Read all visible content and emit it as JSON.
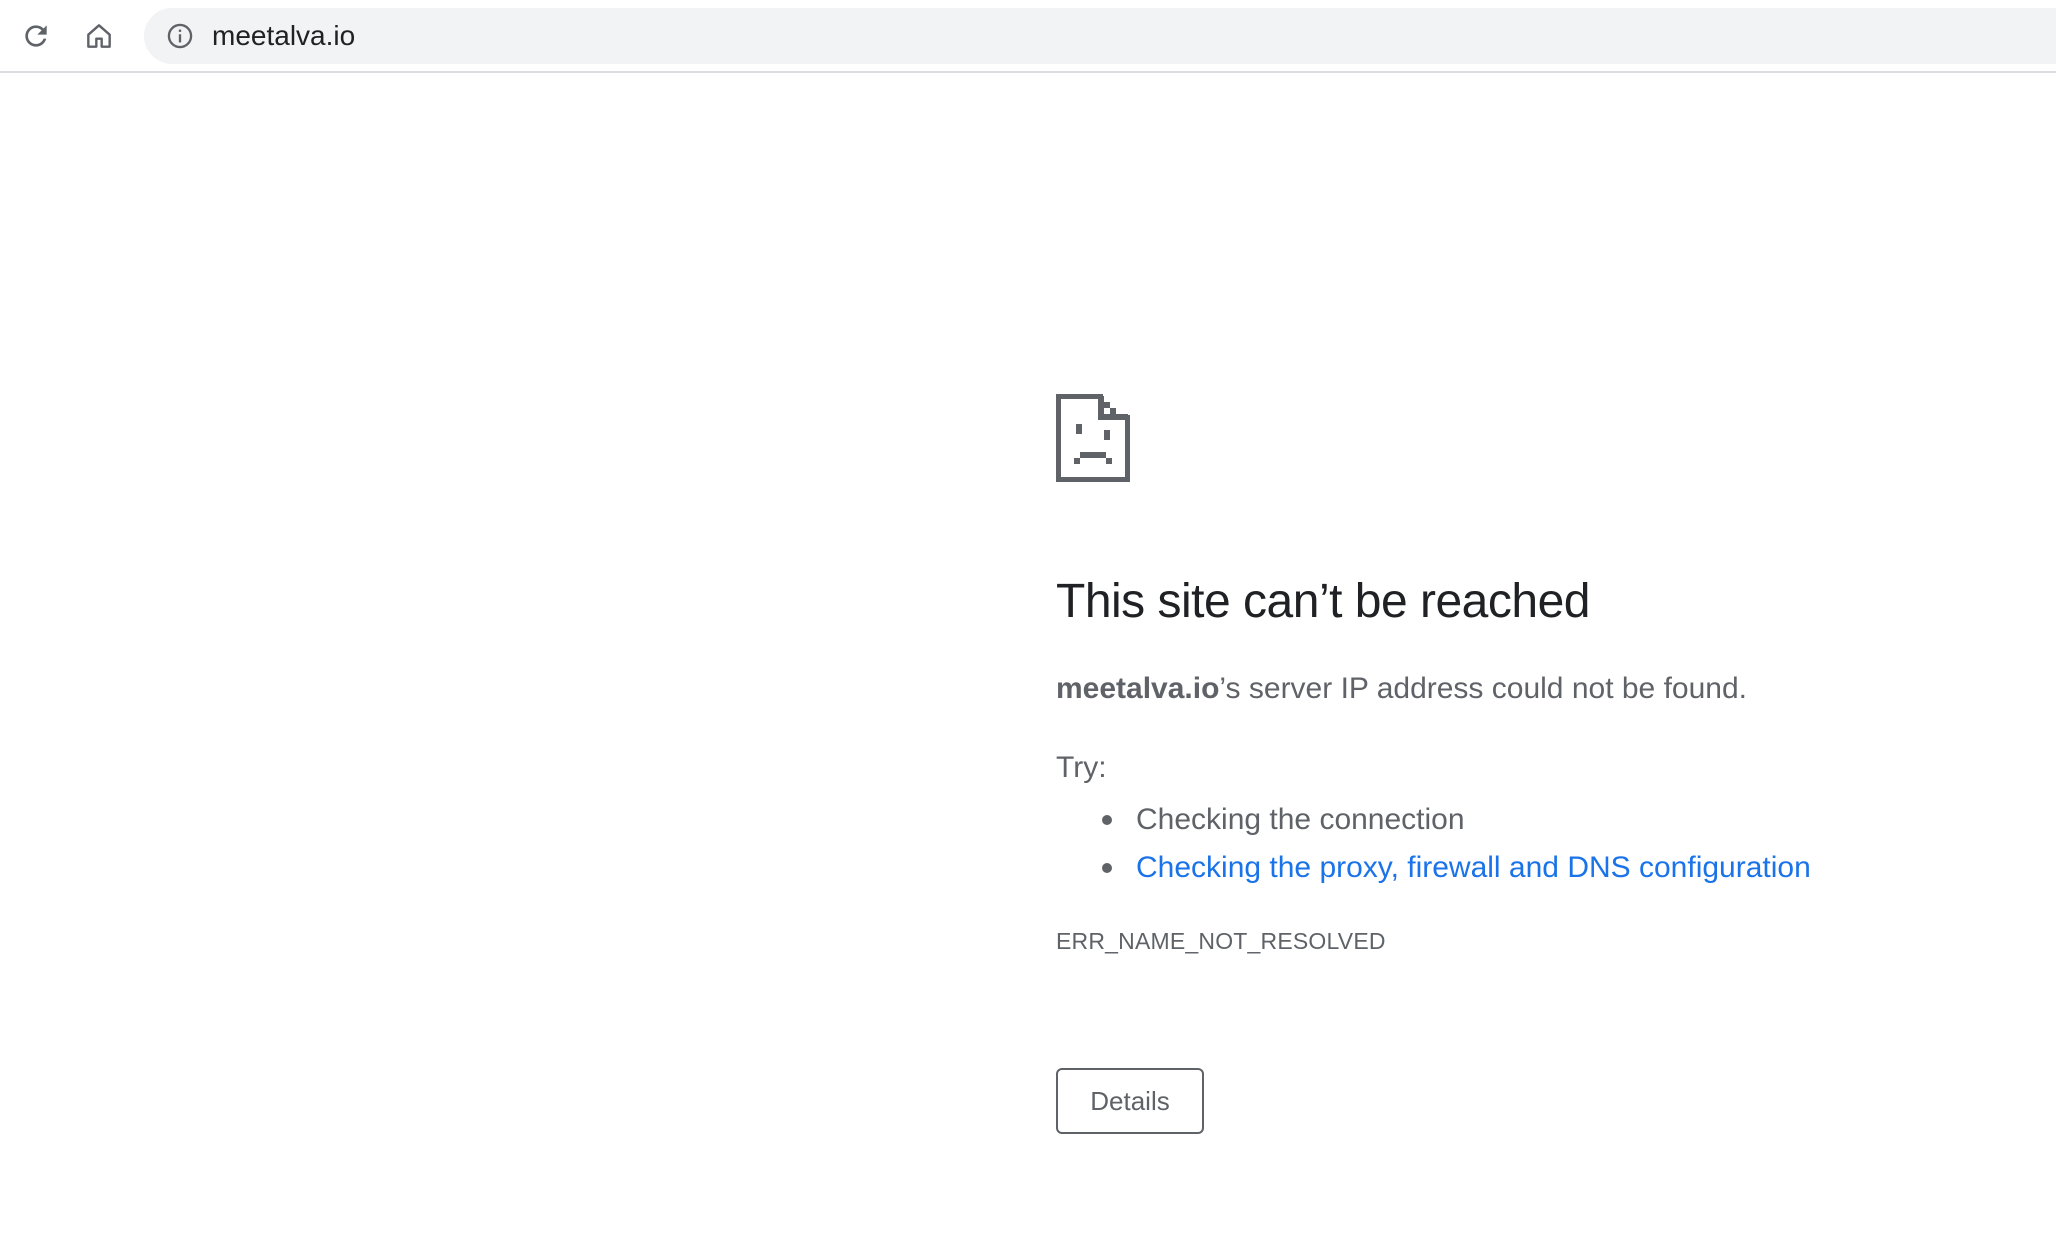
{
  "toolbar": {
    "url": "meetalva.io",
    "reload_icon": "reload-icon",
    "home_icon": "home-icon",
    "info_icon": "info-icon"
  },
  "error_page": {
    "icon": "sad-document-icon",
    "heading": "This site can’t be reached",
    "summary_host": "meetalva.io",
    "summary_rest": "’s server IP address could not be found.",
    "try_label": "Try:",
    "suggestions": [
      {
        "text": "Checking the connection",
        "link": false
      },
      {
        "text": "Checking the proxy, firewall and DNS configuration",
        "link": true
      }
    ],
    "error_code": "ERR_NAME_NOT_RESOLVED",
    "details_label": "Details"
  },
  "colors": {
    "text": "#5f6368",
    "heading": "#202124",
    "link": "#1a73e8",
    "omnibox_bg": "#f1f3f4"
  }
}
